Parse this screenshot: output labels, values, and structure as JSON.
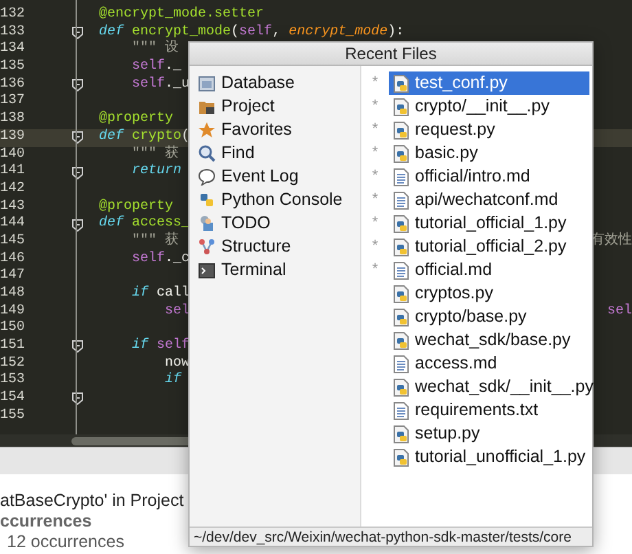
{
  "editor": {
    "lines": [
      {
        "number": "132",
        "tokens": [
          {
            "text": "@encrypt_mode.setter",
            "kind": "decorator"
          }
        ]
      },
      {
        "number": "133",
        "fold": true,
        "tokens": [
          {
            "text": "def",
            "kind": "keyword"
          },
          {
            "text": " encrypt_mode",
            "kind": "function"
          },
          {
            "text": "(",
            "kind": "plain"
          },
          {
            "text": "self",
            "kind": "self"
          },
          {
            "text": ", ",
            "kind": "plain"
          },
          {
            "text": "encrypt_mode",
            "kind": "param"
          },
          {
            "text": "):",
            "kind": "plain"
          }
        ]
      },
      {
        "number": "134",
        "tokens": [
          {
            "text": "    \"\"\" 设",
            "kind": "doc"
          }
        ]
      },
      {
        "number": "135",
        "tokens": [
          {
            "text": "    self",
            "kind": "self"
          },
          {
            "text": "._",
            "kind": "plain"
          }
        ]
      },
      {
        "number": "136",
        "fold": true,
        "tokens": [
          {
            "text": "    self",
            "kind": "self"
          },
          {
            "text": "._u",
            "kind": "plain"
          }
        ]
      },
      {
        "number": "137"
      },
      {
        "number": "138",
        "tokens": [
          {
            "text": "@property",
            "kind": "decorator"
          }
        ]
      },
      {
        "number": "139",
        "fold": true,
        "current": true,
        "tokens": [
          {
            "text": "def",
            "kind": "keyword"
          },
          {
            "text": " crypto",
            "kind": "function"
          },
          {
            "text": "(",
            "kind": "plain"
          }
        ]
      },
      {
        "number": "140",
        "tokens": [
          {
            "text": "    \"\"\" 获",
            "kind": "doc"
          }
        ]
      },
      {
        "number": "141",
        "fold": true,
        "tokens": [
          {
            "text": "    return",
            "kind": "keyword"
          }
        ]
      },
      {
        "number": "142"
      },
      {
        "number": "143",
        "tokens": [
          {
            "text": "@property",
            "kind": "decorator"
          }
        ]
      },
      {
        "number": "144",
        "fold": true,
        "tokens": [
          {
            "text": "def",
            "kind": "keyword"
          },
          {
            "text": " access_",
            "kind": "function"
          }
        ]
      },
      {
        "number": "145",
        "tokens": [
          {
            "text": "    \"\"\" 获",
            "kind": "doc"
          }
        ],
        "right": {
          "text": "有效性",
          "kind": "doc"
        }
      },
      {
        "number": "146",
        "tokens": [
          {
            "text": "    self",
            "kind": "self"
          },
          {
            "text": "._c",
            "kind": "plain"
          }
        ]
      },
      {
        "number": "147"
      },
      {
        "number": "148",
        "tokens": [
          {
            "text": "    if",
            "kind": "keyword"
          },
          {
            "text": " call",
            "kind": "plain"
          }
        ]
      },
      {
        "number": "149",
        "tokens": [
          {
            "text": "        sel",
            "kind": "self"
          }
        ],
        "right": {
          "text": "sel",
          "kind": "self"
        }
      },
      {
        "number": "150"
      },
      {
        "number": "151",
        "fold": true,
        "tokens": [
          {
            "text": "    if",
            "kind": "keyword"
          },
          {
            "text": " self",
            "kind": "self"
          }
        ]
      },
      {
        "number": "152",
        "tokens": [
          {
            "text": "        now",
            "kind": "plain"
          }
        ]
      },
      {
        "number": "153",
        "tokens": [
          {
            "text": "        if",
            "kind": "keyword"
          }
        ]
      },
      {
        "number": "154",
        "fold": true
      },
      {
        "number": "155"
      }
    ]
  },
  "find_panel": {
    "lines": [
      {
        "text": "atBaseCrypto' in Project",
        "kind": "title"
      },
      {
        "text": "ccurrences",
        "kind": "group"
      },
      {
        "text": "12 occurrences",
        "kind": "item"
      }
    ]
  },
  "popup": {
    "title": "Recent Files",
    "tool_windows": [
      {
        "label": "Database"
      },
      {
        "label": "Project"
      },
      {
        "label": "Favorites"
      },
      {
        "label": "Find"
      },
      {
        "label": "Event Log"
      },
      {
        "label": "Python Console"
      },
      {
        "label": "TODO"
      },
      {
        "label": "Structure"
      },
      {
        "label": "Terminal"
      }
    ],
    "files": [
      {
        "name": "test_conf.py",
        "kind": "python",
        "mark": "*",
        "selected": true
      },
      {
        "name": "crypto/__init__.py",
        "kind": "python",
        "mark": "*",
        "selected": false
      },
      {
        "name": "request.py",
        "kind": "python",
        "mark": "*",
        "selected": false
      },
      {
        "name": "basic.py",
        "kind": "python",
        "mark": "*",
        "selected": false
      },
      {
        "name": "official/intro.md",
        "kind": "text",
        "mark": "*",
        "selected": false
      },
      {
        "name": "api/wechatconf.md",
        "kind": "text",
        "mark": "*",
        "selected": false
      },
      {
        "name": "tutorial_official_1.py",
        "kind": "python",
        "mark": "*",
        "selected": false
      },
      {
        "name": "tutorial_official_2.py",
        "kind": "python",
        "mark": "*",
        "selected": false
      },
      {
        "name": "official.md",
        "kind": "text",
        "mark": "*",
        "selected": false
      },
      {
        "name": "cryptos.py",
        "kind": "python",
        "selected": false
      },
      {
        "name": "crypto/base.py",
        "kind": "python",
        "selected": false
      },
      {
        "name": "wechat_sdk/base.py",
        "kind": "python",
        "selected": false
      },
      {
        "name": "access.md",
        "kind": "text",
        "selected": false
      },
      {
        "name": "wechat_sdk/__init__.py",
        "kind": "python",
        "selected": false
      },
      {
        "name": "requirements.txt",
        "kind": "text",
        "selected": false
      },
      {
        "name": "setup.py",
        "kind": "python",
        "selected": false
      },
      {
        "name": "tutorial_unofficial_1.py",
        "kind": "python",
        "selected": false
      }
    ],
    "path": "~/dev/dev_src/Weixin/wechat-python-sdk-master/tests/core"
  }
}
